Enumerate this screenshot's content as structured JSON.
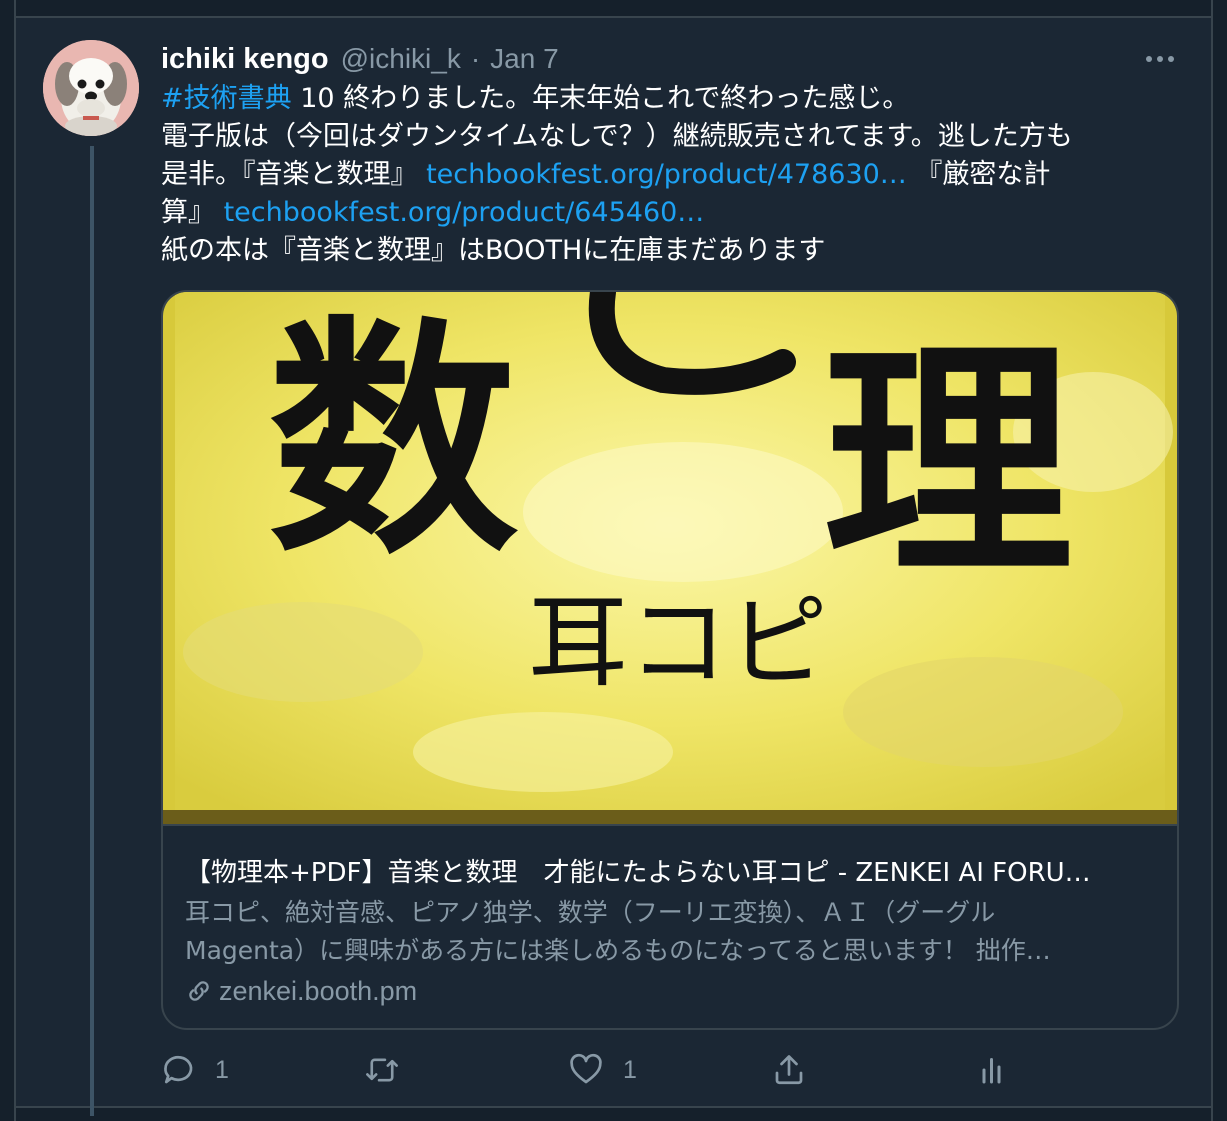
{
  "tweet": {
    "display_name": "ichiki kengo",
    "handle": "@ichiki_k",
    "separator": "·",
    "date": "Jan 7",
    "lines": {
      "l1_hashtag": "#技術書典",
      "l1_rest": " 10 終わりました。年末年始これで終わった感じ。",
      "l2": "電子版は（今回はダウンタイムなしで？）継続販売されてます。逃した方も",
      "l3_pre": "是非。『音楽と数理』 ",
      "l3_link": "techbookfest.org/product/478630…",
      "l3_post": " 『厳密な計",
      "l4_pre": "算』 ",
      "l4_link": "techbookfest.org/product/645460…",
      "l5": "紙の本は『音楽と数理』はBOOTHに在庫まだあります"
    }
  },
  "card": {
    "image_text": {
      "big_left": "数",
      "big_right": "理",
      "subtitle": "耳コピ"
    },
    "title": "【物理本+PDF】音楽と数理　才能にたよらない耳コピ - ZENKEI AI FORU…",
    "description_line1": "耳コピ、絶対音感、ピアノ独学、数学（フーリエ変換）、ＡＩ（グーグル",
    "description_line2": "Magenta）に興味がある方には楽しめるものになってると思います！ 拙作…",
    "domain": "zenkei.booth.pm"
  },
  "actions": {
    "reply_count": "1",
    "like_count": "1"
  },
  "colors": {
    "background": "#15202b",
    "tweet_bg": "#1b2734",
    "link": "#1da1f2",
    "muted": "#8899a6",
    "border": "#38444d",
    "card_yellow": "#f3e96b"
  }
}
